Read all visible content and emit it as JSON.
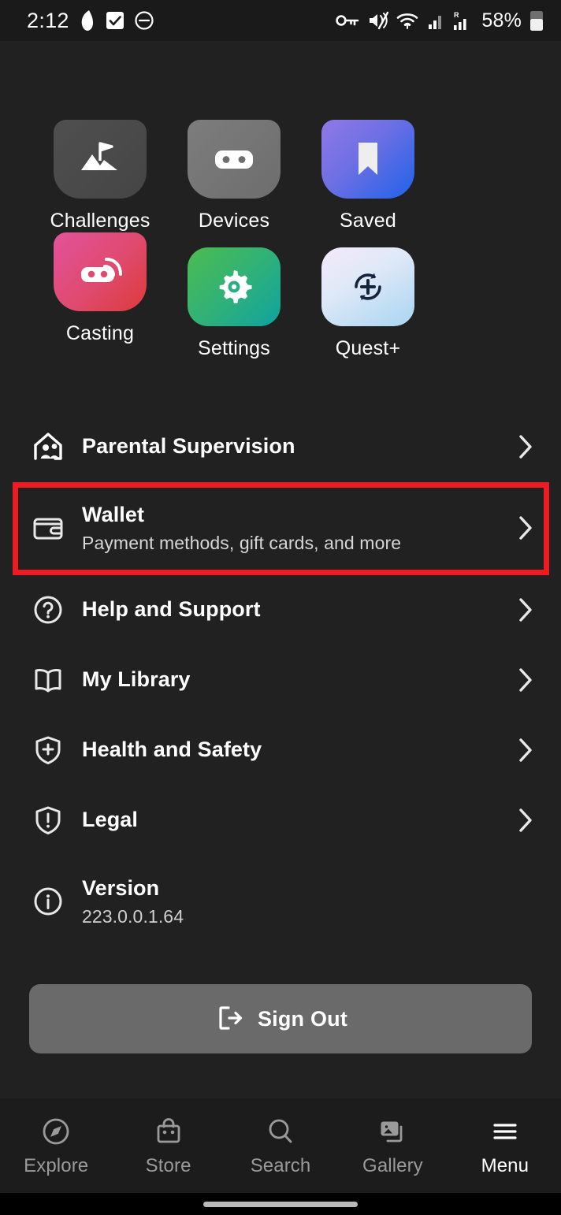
{
  "status_bar": {
    "clock": "2:12",
    "battery_percent": "58%",
    "left_icons": [
      "app-badge-icon",
      "checkbox-checked-icon",
      "do-not-disturb-icon"
    ],
    "right_icons": [
      "vpn-key-icon",
      "volume-muted-icon",
      "wifi-icon",
      "signal-bars-icon",
      "roaming-signal-icon",
      "battery-icon"
    ]
  },
  "tiles": [
    {
      "label": "Challenges",
      "icon": "mountain-flag-icon",
      "shape": "squareish",
      "bg_from": "#4f4f4f",
      "bg_to": "#484848"
    },
    {
      "label": "Devices",
      "icon": "vr-headset-icon",
      "shape": "squareish",
      "bg_from": "#7b7b7b",
      "bg_to": "#6f6f6f"
    },
    {
      "label": "Saved",
      "icon": "bookmark-icon",
      "shape": "squareish",
      "bg_from": "#8e7ae0",
      "bg_to": "#1f64e8"
    },
    {
      "label": "Casting",
      "icon": "cast-headset-icon",
      "shape": "squareish",
      "bg_from": "#e0548f",
      "bg_to": "#e03a3a"
    },
    {
      "label": "Settings",
      "icon": "gear-icon",
      "shape": "rounded",
      "bg_from": "#46b84f",
      "bg_to": "#12a39c"
    },
    {
      "label": "Quest+",
      "icon": "quest-plus-icon",
      "shape": "rounded",
      "bg_from": "#f3e8f7",
      "bg_to": "#a8d4f0"
    }
  ],
  "menu_rows": [
    {
      "title": "Parental Supervision",
      "subtitle": "",
      "icon": "house-family-icon",
      "chevron": true,
      "highlighted": false
    },
    {
      "title": "Wallet",
      "subtitle": "Payment methods, gift cards, and more",
      "icon": "wallet-icon",
      "chevron": true,
      "highlighted": true
    },
    {
      "title": "Help and Support",
      "subtitle": "",
      "icon": "question-circle-icon",
      "chevron": true,
      "highlighted": false
    },
    {
      "title": "My Library",
      "subtitle": "",
      "icon": "open-book-icon",
      "chevron": true,
      "highlighted": false
    },
    {
      "title": "Health and Safety",
      "subtitle": "",
      "icon": "shield-plus-icon",
      "chevron": true,
      "highlighted": false
    },
    {
      "title": "Legal",
      "subtitle": "",
      "icon": "shield-exclamation-icon",
      "chevron": true,
      "highlighted": false
    },
    {
      "title": "Version",
      "subtitle": "223.0.0.1.64",
      "icon": "info-circle-icon",
      "chevron": false,
      "highlighted": false
    }
  ],
  "sign_out": {
    "label": "Sign Out",
    "icon": "sign-out-icon",
    "background": "#6a6a6a"
  },
  "bottom_nav": {
    "items": [
      {
        "label": "Explore",
        "icon": "compass-icon",
        "active": false
      },
      {
        "label": "Store",
        "icon": "shopping-bag-icon",
        "active": false
      },
      {
        "label": "Search",
        "icon": "search-icon",
        "active": false
      },
      {
        "label": "Gallery",
        "icon": "photos-icon",
        "active": false
      },
      {
        "label": "Menu",
        "icon": "hamburger-menu-icon",
        "active": true
      }
    ]
  },
  "annotation": {
    "highlight_color": "#ee1b22",
    "target": "Wallet"
  },
  "theme": {
    "background": "#212121",
    "status_bar_background": "#1a1a1a",
    "nav_background": "#1c1c1c",
    "text_primary": "#ffffff",
    "text_secondary": "#d6d6d6",
    "text_muted": "#9a9a9a"
  }
}
